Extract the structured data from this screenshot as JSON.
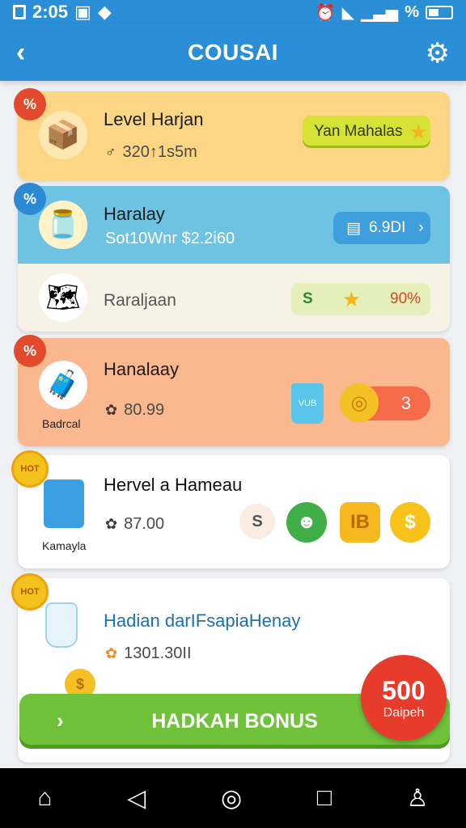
{
  "status_bar": {
    "time": "2:05",
    "percent": "%"
  },
  "header": {
    "title": "COUSAI",
    "back_icon": "chevron-left-icon",
    "settings_icon": "gear-icon"
  },
  "cards": [
    {
      "title": "Level Harjan",
      "subtitle": "320↑1s5m",
      "pill_label": "Yan Mahalas",
      "pill_color": "#d6e234"
    },
    {
      "title": "Haralay",
      "subtitle": "Sot10Wnr $2.2i60",
      "pill_label": "6.9DI"
    },
    {
      "title": "Raraljaan",
      "pill_s": "S",
      "pill_percent": "90%"
    },
    {
      "title": "Hanalaay",
      "thumb_label": "Badrcal",
      "subtitle": "80.99",
      "bucket_label": "VUB",
      "count": "3"
    },
    {
      "title": "Hervel a Hameau",
      "thumb_label": "Kamayla",
      "subtitle": "87.00",
      "coins": [
        "S",
        "",
        "IB",
        "$"
      ]
    },
    {
      "title": "Hadian darIFsapiaHenay",
      "subtitle": "1301.30II"
    }
  ],
  "bonus": {
    "button_label": "HADKAH BONUS",
    "badge_value": "500",
    "badge_label": "Daipeh"
  },
  "nav": [
    "home-icon",
    "back-triangle-icon",
    "circle-icon",
    "square-icon",
    "person-icon"
  ]
}
